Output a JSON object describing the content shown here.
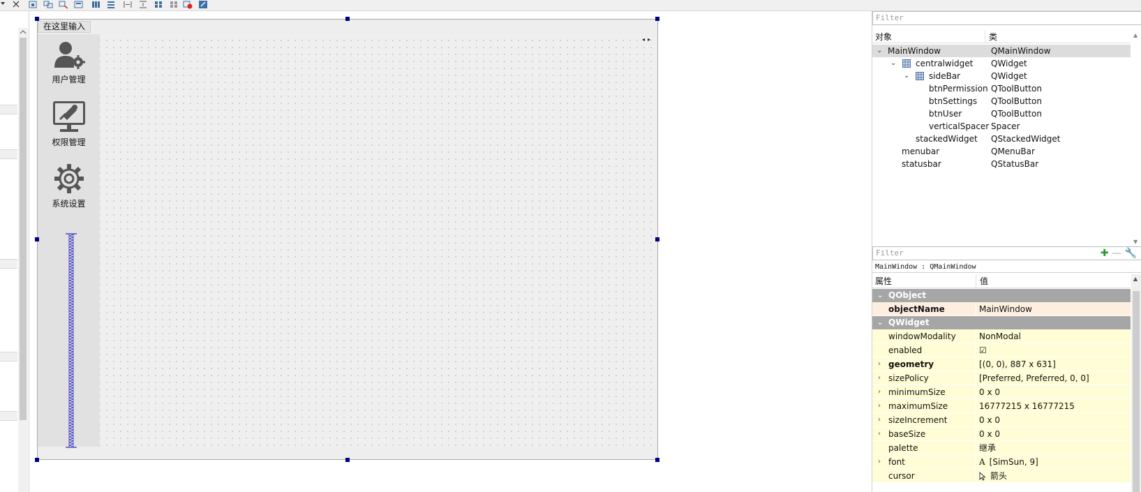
{
  "form": {
    "menu_placeholder": "在这里输入",
    "sidebar_buttons": [
      {
        "label": "用户管理",
        "icon": "user-gear-icon"
      },
      {
        "label": "权限管理",
        "icon": "monitor-tools-icon"
      },
      {
        "label": "系统设置",
        "icon": "gear-icon"
      }
    ]
  },
  "object_inspector": {
    "filter_placeholder": "Filter",
    "headers": {
      "object": "对象",
      "class": "类"
    },
    "rows": [
      {
        "name": "MainWindow",
        "class": "QMainWindow"
      },
      {
        "name": "centralwidget",
        "class": "QWidget"
      },
      {
        "name": "sideBar",
        "class": "QWidget"
      },
      {
        "name": "btnPermission",
        "class": "QToolButton"
      },
      {
        "name": "btnSettings",
        "class": "QToolButton"
      },
      {
        "name": "btnUser",
        "class": "QToolButton"
      },
      {
        "name": "verticalSpacer",
        "class": "Spacer"
      },
      {
        "name": "stackedWidget",
        "class": "QStackedWidget"
      },
      {
        "name": "menubar",
        "class": "QMenuBar"
      },
      {
        "name": "statusbar",
        "class": "QStatusBar"
      }
    ]
  },
  "property_editor": {
    "filter_placeholder": "Filter",
    "title": "MainWindow : QMainWindow",
    "headers": {
      "property": "属性",
      "value": "值"
    },
    "sections": [
      {
        "label": "QObject"
      },
      {
        "label": "QWidget"
      }
    ],
    "rows": [
      {
        "name": "objectName",
        "value": "MainWindow"
      },
      {
        "name": "windowModality",
        "value": "NonModal"
      },
      {
        "name": "enabled",
        "value": "☑"
      },
      {
        "name": "geometry",
        "value": "[(0, 0), 887 x 631]"
      },
      {
        "name": "sizePolicy",
        "value": "[Preferred, Preferred, 0, 0]"
      },
      {
        "name": "minimumSize",
        "value": "0 x 0"
      },
      {
        "name": "maximumSize",
        "value": "16777215 x 16777215"
      },
      {
        "name": "sizeIncrement",
        "value": "0 x 0"
      },
      {
        "name": "baseSize",
        "value": "0 x 0"
      },
      {
        "name": "palette",
        "value": "继承"
      },
      {
        "name": "font",
        "value": "[SimSun, 9]"
      },
      {
        "name": "cursor",
        "value": "箭头"
      }
    ]
  },
  "colors": {
    "section_header": "#a6a6a6",
    "changed_row": "#fdeee0",
    "prop_row": "#fffdd6",
    "selected_row": "#dcdcdc",
    "selection_handle": "#000080"
  }
}
